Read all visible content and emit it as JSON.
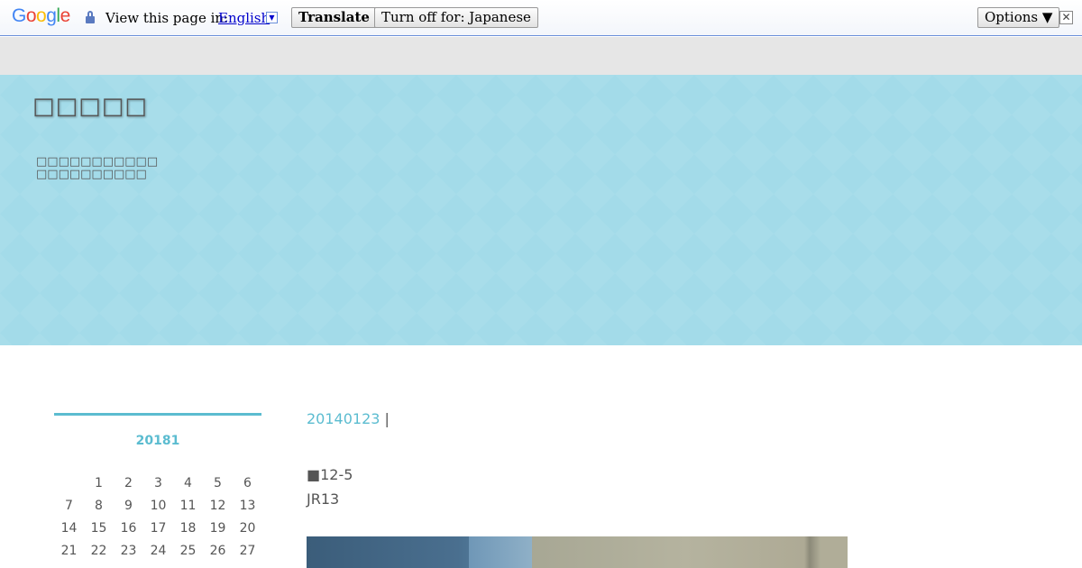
{
  "translate_bar": {
    "logo_text": "Google",
    "view_label": "View this page in:",
    "language": "English",
    "dropdown_glyph": "▼",
    "translate_button": "Translate",
    "turn_off_button": "Turn off for: Japanese",
    "options_button": "Options ▼",
    "close_glyph": "✕"
  },
  "header": {
    "site_title": "□□□□□",
    "description_line1": "□□□□□□□□□□□",
    "description_line2": "□□□□□□□□□□"
  },
  "calendar": {
    "title": "20181",
    "days": [
      "",
      "1",
      "2",
      "3",
      "4",
      "5",
      "6",
      "7",
      "8",
      "9",
      "10",
      "11",
      "12",
      "13",
      "14",
      "15",
      "16",
      "17",
      "18",
      "19",
      "20",
      "21",
      "22",
      "23",
      "24",
      "25",
      "26",
      "27"
    ]
  },
  "post": {
    "date_link": "20140123",
    "date_sep": " |",
    "line1": "■12-5",
    "line2": "JR13"
  },
  "colors": {
    "accent": "#5bbcd0",
    "header_bg": "#a3dbe9",
    "nav_strip": "#e6e6e6",
    "text": "#555555"
  }
}
